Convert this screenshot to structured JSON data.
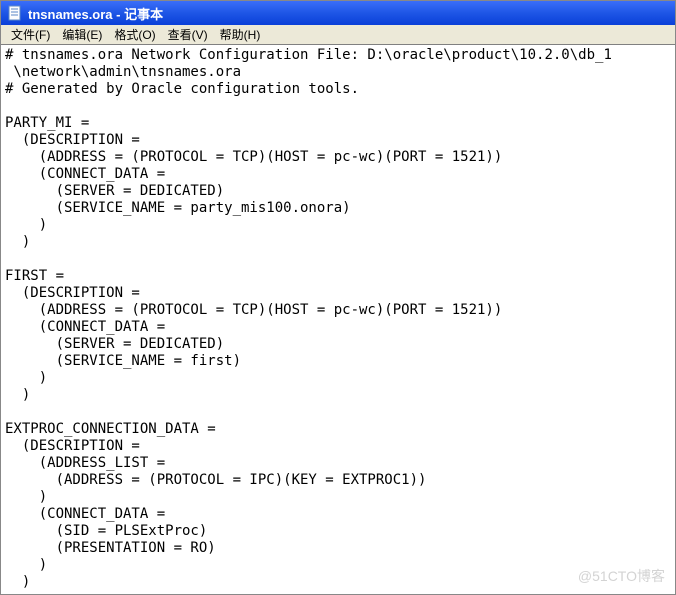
{
  "window": {
    "title": "tnsnames.ora - 记事本"
  },
  "menu": {
    "items": [
      {
        "label": "文件(F)"
      },
      {
        "label": "编辑(E)"
      },
      {
        "label": "格式(O)"
      },
      {
        "label": "查看(V)"
      },
      {
        "label": "帮助(H)"
      }
    ]
  },
  "content": {
    "text": "# tnsnames.ora Network Configuration File: D:\\oracle\\product\\10.2.0\\db_1\n \\network\\admin\\tnsnames.ora\n# Generated by Oracle configuration tools.\n\nPARTY_MI =\n  (DESCRIPTION =\n    (ADDRESS = (PROTOCOL = TCP)(HOST = pc-wc)(PORT = 1521))\n    (CONNECT_DATA =\n      (SERVER = DEDICATED)\n      (SERVICE_NAME = party_mis100.onora)\n    )\n  )\n\nFIRST =\n  (DESCRIPTION =\n    (ADDRESS = (PROTOCOL = TCP)(HOST = pc-wc)(PORT = 1521))\n    (CONNECT_DATA =\n      (SERVER = DEDICATED)\n      (SERVICE_NAME = first)\n    )\n  )\n\nEXTPROC_CONNECTION_DATA =\n  (DESCRIPTION =\n    (ADDRESS_LIST =\n      (ADDRESS = (PROTOCOL = IPC)(KEY = EXTPROC1))\n    )\n    (CONNECT_DATA =\n      (SID = PLSExtProc)\n      (PRESENTATION = RO)\n    )\n  )"
  },
  "watermark": {
    "text": "@51CTO博客"
  }
}
